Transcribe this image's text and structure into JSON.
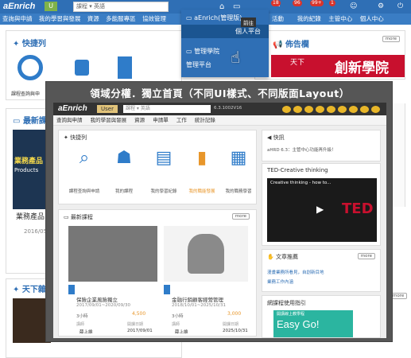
{
  "bg": {
    "logo": "aEnrich",
    "user_label": "U",
    "search_value": "課程 ▾ 英語",
    "nav": [
      "查詢與申請",
      "我的學習與發展",
      "資源",
      "多能服專區",
      "協效管理"
    ],
    "nav_right": [
      "我的紀錄",
      "主管中心",
      "個人中心"
    ],
    "nav_right_mid": "活動",
    "badges": [
      "18",
      "96",
      "99+",
      "1"
    ],
    "quick_title": "快捷列",
    "quick_label": "課程查詢與申",
    "latest_title": "最新課",
    "course_banner": "業務產品",
    "course_banner_sub": "Products",
    "course_title": "業務產品",
    "course_date": "2016/05/",
    "news_title": "天下雜",
    "board_title": "佈告欄",
    "board_more": "more",
    "banner_text": "創新學院",
    "banner_sub": "天下"
  },
  "dropdown": {
    "items": [
      "aEnrich(管理版)",
      "個人平台",
      "管理學院",
      "管理平台"
    ],
    "tooltip": "前往"
  },
  "panel": {
    "title": "領域分權．獨立首頁（不同UI樣式、不同版面Layout）",
    "logo": "aEnrich",
    "user": "User",
    "search": "課程 ▾ 英語",
    "version": "6.3.1002V16",
    "nav": [
      "查詢與申請",
      "我的學習與發展",
      "資源",
      "申請單",
      "工作",
      "統計記錄"
    ],
    "quick": {
      "title": "快捷列",
      "items": [
        "課程查詢與申請",
        "我的課程",
        "我的學習紀錄",
        "我的職能發展",
        "我的職務學習"
      ]
    },
    "latest": {
      "title": "最新課程",
      "more": "more",
      "courses": [
        {
          "name": "保險企業風險獨立",
          "date": "2017/09/01~2020/09/30",
          "hours": "3小時",
          "points": "4,500",
          "teacher_label": "講師",
          "teacher": "薛上維",
          "start_label": "開課日期",
          "start": "2017/09/01"
        },
        {
          "name": "金融行銷顧客經營管理",
          "date": "2018/10/01~2025/10/31",
          "hours": "3小時",
          "points": "3,000",
          "teacher_label": "講師",
          "teacher": "薛上維",
          "start_label": "開課日期",
          "start": "2025/10/31"
        }
      ]
    },
    "notice": {
      "title": "快訊",
      "text": "aHRD 6.3：主管中心功能再升級！"
    },
    "ted": {
      "title": "TED-Creative thinking",
      "video": "Creative thinking - how to...",
      "logo": "TED"
    },
    "article": {
      "title": "文章推薦",
      "more": "more",
      "items": [
        "漫畫業務所看見，自創新目地",
        "業務工作內涵"
      ]
    },
    "tips": {
      "title": "網課程使用指引",
      "head": "開講線上教學程",
      "text": "Easy Go!"
    }
  },
  "colors": {
    "brand": "#2f6fb5",
    "dark": "#333333",
    "accent": "#e8b629",
    "panel": "#565656"
  }
}
